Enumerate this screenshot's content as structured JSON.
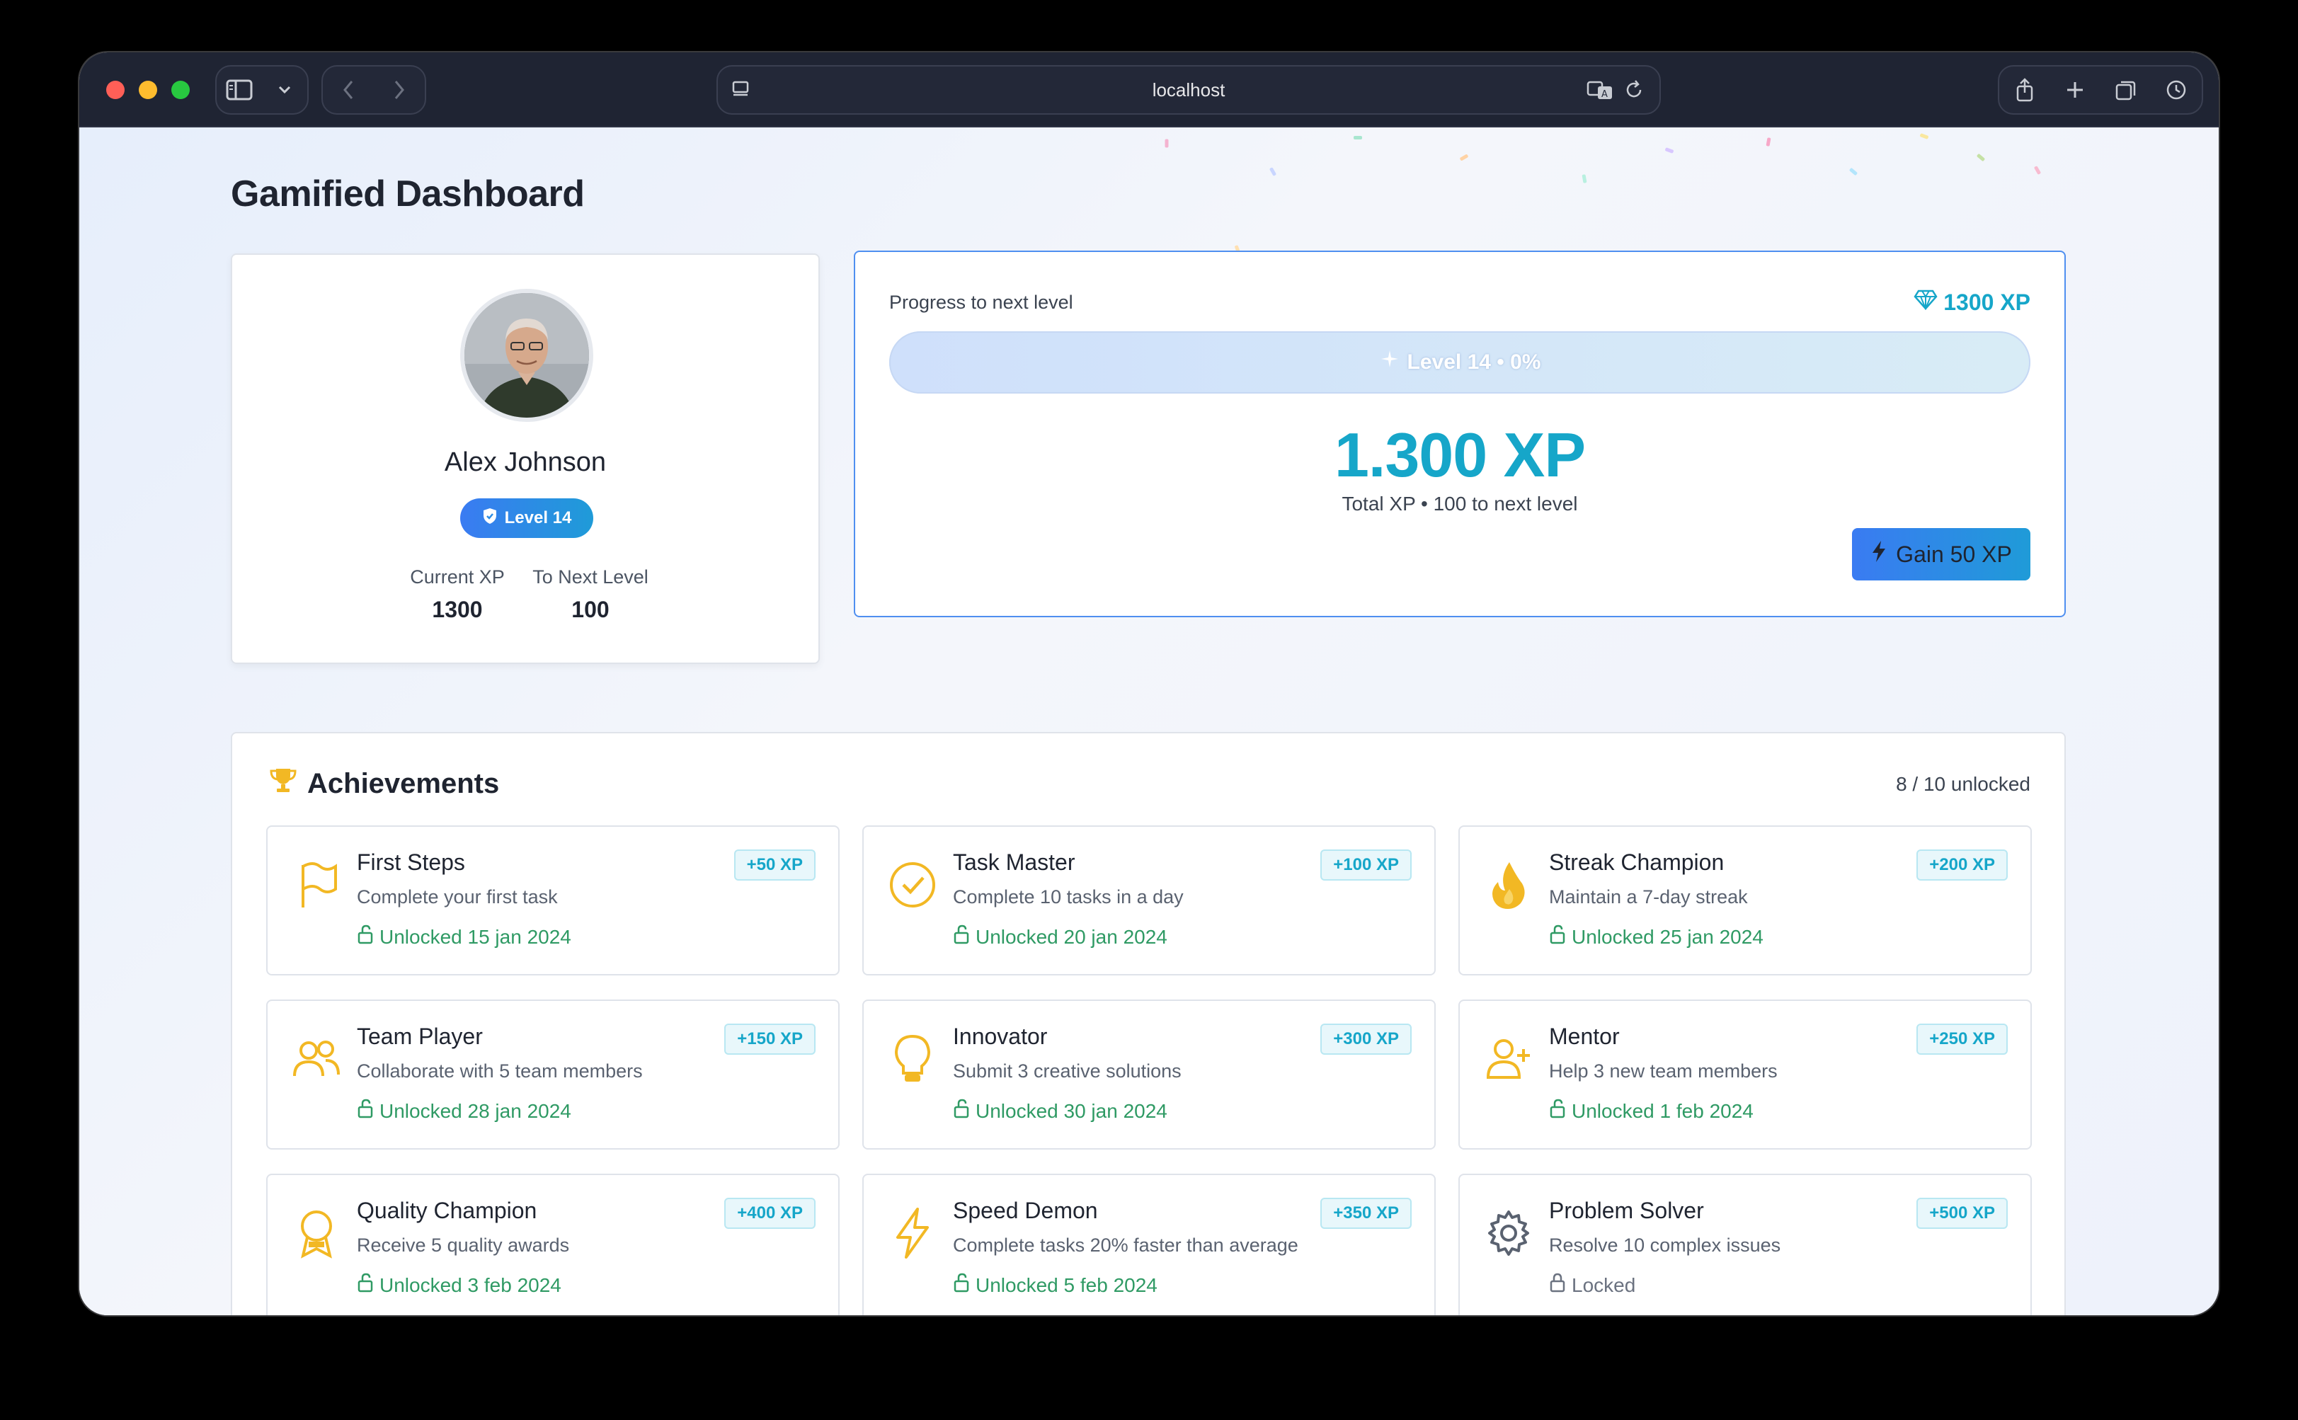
{
  "browser": {
    "url": "localhost"
  },
  "page": {
    "title": "Gamified Dashboard"
  },
  "profile": {
    "name": "Alex Johnson",
    "level_label": "Level 14",
    "current_xp_label": "Current XP",
    "current_xp_value": "1300",
    "to_next_label": "To Next Level",
    "to_next_value": "100"
  },
  "progress": {
    "label": "Progress to next level",
    "xp_badge": "1300 XP",
    "bar_text": "Level 14 • 0%",
    "bar_fraction": 0,
    "big_xp": "1.300 XP",
    "sub_text": "Total XP • 100 to next level",
    "gain_button": "Gain 50 XP"
  },
  "achievements": {
    "title": "Achievements",
    "count": "8 / 10 unlocked",
    "items": [
      {
        "name": "First Steps",
        "desc": "Complete your first task",
        "status": "Unlocked 15 jan 2024",
        "xp": "+50 XP",
        "icon": "flag-icon"
      },
      {
        "name": "Task Master",
        "desc": "Complete 10 tasks in a day",
        "status": "Unlocked 20 jan 2024",
        "xp": "+100 XP",
        "icon": "check-circle-icon"
      },
      {
        "name": "Streak Champion",
        "desc": "Maintain a 7-day streak",
        "status": "Unlocked 25 jan 2024",
        "xp": "+200 XP",
        "icon": "flame-icon"
      },
      {
        "name": "Team Player",
        "desc": "Collaborate with 5 team members",
        "status": "Unlocked 28 jan 2024",
        "xp": "+150 XP",
        "icon": "users-icon"
      },
      {
        "name": "Innovator",
        "desc": "Submit 3 creative solutions",
        "status": "Unlocked 30 jan 2024",
        "xp": "+300 XP",
        "icon": "lightbulb-icon"
      },
      {
        "name": "Mentor",
        "desc": "Help 3 new team members",
        "status": "Unlocked 1 feb 2024",
        "xp": "+250 XP",
        "icon": "user-plus-icon"
      },
      {
        "name": "Quality Champion",
        "desc": "Receive 5 quality awards",
        "status": "Unlocked 3 feb 2024",
        "xp": "+400 XP",
        "icon": "award-icon"
      },
      {
        "name": "Speed Demon",
        "desc": "Complete tasks 20% faster than average",
        "status": "Unlocked 5 feb 2024",
        "xp": "+350 XP",
        "icon": "lightning-icon"
      },
      {
        "name": "Problem Solver",
        "desc": "Resolve 10 complex issues",
        "status": "Locked",
        "xp": "+500 XP",
        "icon": "gear-icon"
      }
    ]
  },
  "colors": {
    "accent": "#16a6c9",
    "primary": "#3a7bf2",
    "success": "#2f9a64",
    "icon_gold": "#f2b824"
  }
}
